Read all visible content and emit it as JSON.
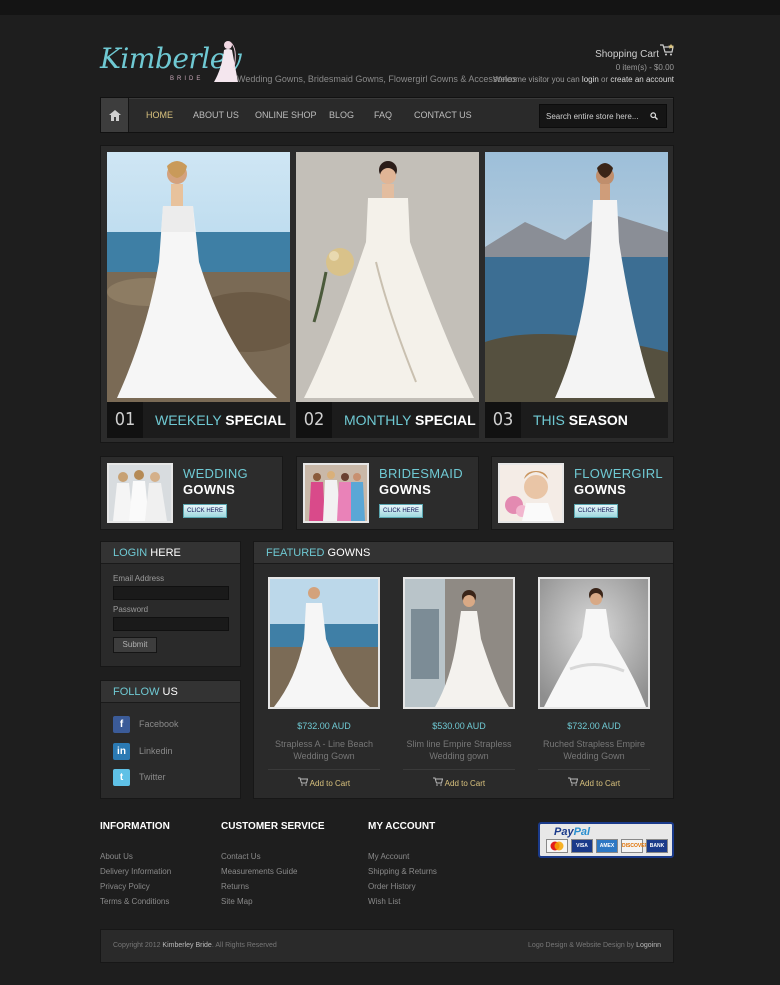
{
  "header": {
    "logo_text": "Kimberley",
    "logo_sub": "BRIDE",
    "tagline": "Wedding Gowns, Bridesmaid Gowns, Flowergirl Gowns & Accessories",
    "cart_title": "Shopping Cart",
    "cart_count": "0 item(s) - $0.00",
    "welcome_prefix": "Welcome visitor you can ",
    "login_link": "login",
    "welcome_mid": " or ",
    "create_link": "create an account"
  },
  "nav": {
    "items": [
      "HOME",
      "ABOUT US",
      "ONLINE SHOP",
      "BLOG",
      "FAQ",
      "CONTACT US"
    ],
    "active": "HOME",
    "search_placeholder": "Search entire store here..."
  },
  "slides": [
    {
      "num": "01",
      "title_a": "WEEKELY",
      "title_b": "SPECIAL"
    },
    {
      "num": "02",
      "title_a": "MONTHLY",
      "title_b": "SPECIAL"
    },
    {
      "num": "03",
      "title_a": "THIS",
      "title_b": "SEASON"
    }
  ],
  "categories": [
    {
      "line1": "WEDDING",
      "line2": "GOWNS",
      "button": "CLICK HERE"
    },
    {
      "line1": "BRIDESMAID",
      "line2": "GOWNS",
      "button": "CLICK HERE"
    },
    {
      "line1": "FLOWERGIRL",
      "line2": "GOWNS",
      "button": "CLICK HERE"
    }
  ],
  "login": {
    "head_a": "LOGIN",
    "head_b": "HERE",
    "email_label": "Email Address",
    "password_label": "Password",
    "submit": "Submit"
  },
  "follow": {
    "head_a": "FOLLOW",
    "head_b": "US",
    "items": [
      "Facebook",
      "Linkedin",
      "Twitter"
    ]
  },
  "featured": {
    "head_a": "FEATURED",
    "head_b": "GOWNS",
    "products": [
      {
        "price": "$732.00 AUD",
        "name_1": "Strapless A - Line Beach",
        "name_2": "Wedding Gown",
        "cart": "Add to Cart"
      },
      {
        "price": "$530.00 AUD",
        "name_1": "Slim line Empire Strapless",
        "name_2": "Wedding gown",
        "cart": "Add to Cart"
      },
      {
        "price": "$732.00 AUD",
        "name_1": "Ruched Strapless Empire",
        "name_2": "Wedding Gown",
        "cart": "Add to Cart"
      }
    ]
  },
  "footer": {
    "info": {
      "title": "INFORMATION",
      "links": [
        "About Us",
        "Delivery Information",
        "Privacy Policy",
        "Terms & Conditions"
      ]
    },
    "service": {
      "title": "CUSTOMER SERVICE",
      "links": [
        "Contact Us",
        "Measurements Guide",
        "Returns",
        "Site Map"
      ]
    },
    "account": {
      "title": "MY ACCOUNT",
      "links": [
        "My Account",
        "Shipping & Returns",
        "Order History",
        "Wish List"
      ]
    },
    "paypal_a": "Pay",
    "paypal_b": "Pal",
    "cards": [
      "MasterCard",
      "VISA",
      "AMEX",
      "DISCOVER",
      "BANK"
    ],
    "copyright_prefix": "Copyright 2012 ",
    "copyright_brand": "Kimberley Bride",
    "copyright_suffix": ". All Rights Reserved",
    "credit_prefix": "Logo Design & Website Design by ",
    "credit_brand": "Logoinn"
  },
  "colors": {
    "accent": "#6fc9d3",
    "highlight": "#d9c27e",
    "background": "#1e1e1e"
  }
}
